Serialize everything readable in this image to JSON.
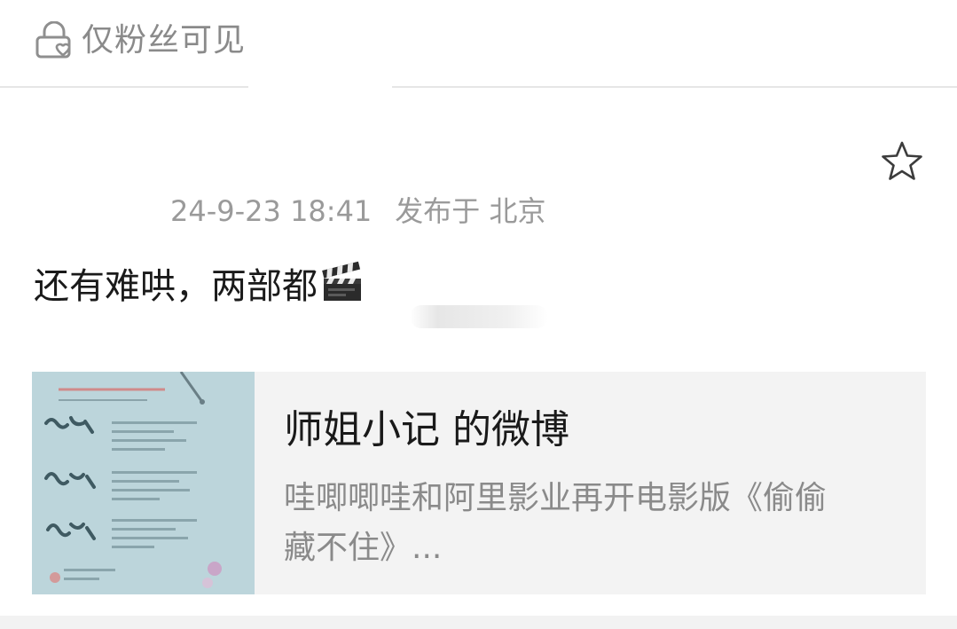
{
  "visibility": {
    "label": "仅粉丝可见",
    "icon": "lock-heart-icon"
  },
  "post": {
    "favorite_icon": "star-icon",
    "timestamp": "24-9-23 18:41",
    "location": "发布于 北京",
    "text": "还有难哄，两部都",
    "emoji": "clapper-board-icon"
  },
  "link_card": {
    "thumbnail": "poster-thumbnail",
    "title": "师姐小记 的微博",
    "description_line1": "哇唧唧哇和阿里影业再开电影版《偷偷",
    "description_line2": "藏不住》..."
  },
  "colors": {
    "secondary_text": "#8a8a8a",
    "meta_text": "#9a9a9a",
    "card_background": "#f3f3f3",
    "thumbnail_tint": "#b8d2d9"
  }
}
